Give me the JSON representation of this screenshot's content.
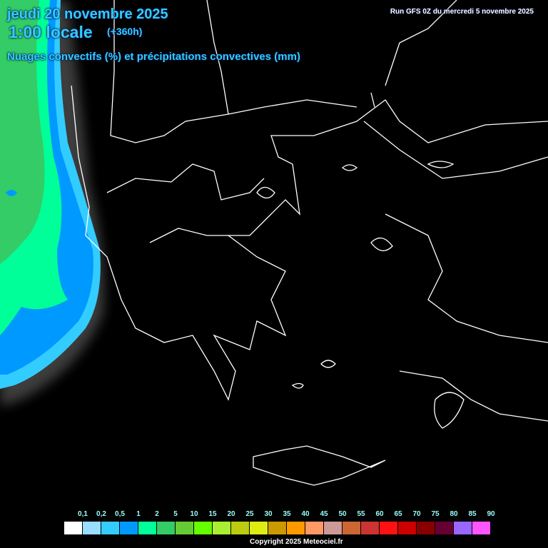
{
  "header": {
    "date": "jeudi 20 novembre 2025",
    "time": "1:00 locale",
    "lead": "(+360h)",
    "parameter": "Nuages convectifs (%) et précipitations convectives (mm)",
    "run": "Run GFS 0Z du mercredi 5 novembre 2025"
  },
  "legend": {
    "labels": [
      "0,1",
      "0,2",
      "0,5",
      "1",
      "2",
      "5",
      "10",
      "15",
      "20",
      "25",
      "30",
      "35",
      "40",
      "45",
      "50",
      "55",
      "60",
      "65",
      "70",
      "75",
      "80",
      "85",
      "90"
    ],
    "colors": [
      "#ffffff",
      "#99ddff",
      "#33ccff",
      "#0099ff",
      "#00ff99",
      "#33cc66",
      "#66cc33",
      "#66ff00",
      "#aaee33",
      "#bbcc11",
      "#dded11",
      "#cc9900",
      "#ff9900",
      "#ff9966",
      "#cc9999",
      "#cc6633",
      "#cc3333",
      "#ff1111",
      "#cc0000",
      "#880000",
      "#660033",
      "#9966ff",
      "#ff55ff"
    ]
  },
  "footer": {
    "copyright": "Copyright 2025 Meteociel.fr"
  }
}
